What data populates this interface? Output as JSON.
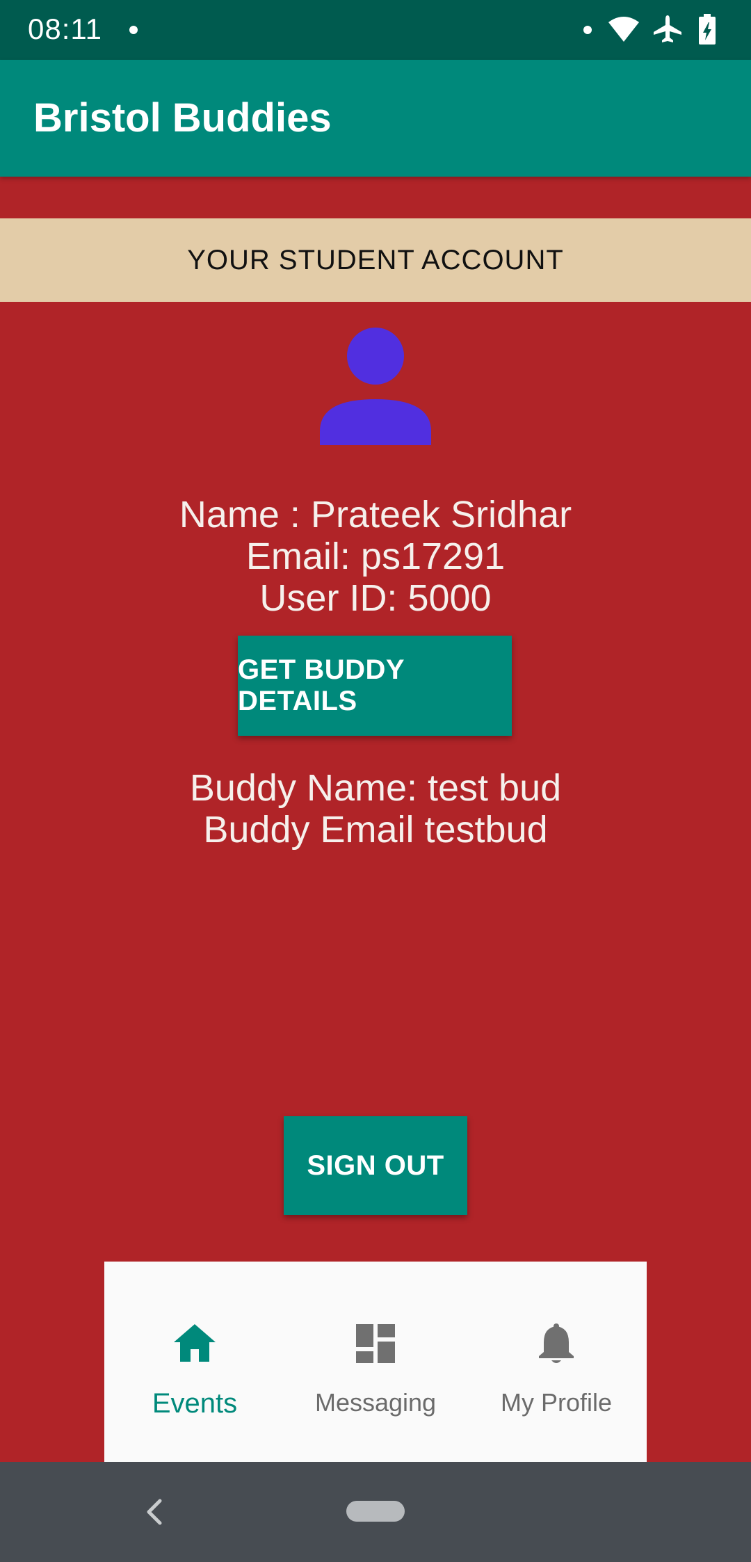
{
  "status_bar": {
    "time": "08:11"
  },
  "app_bar": {
    "title": "Bristol Buddies"
  },
  "banner": {
    "text": "YOUR STUDENT ACCOUNT"
  },
  "profile": {
    "avatar_icon": "person-icon",
    "avatar_color": "#512fe0",
    "name_line": "Name : Prateek Sridhar",
    "email_line": "Email: ps17291",
    "user_id_line": "User ID: 5000"
  },
  "buttons": {
    "get_buddy_details": "GET BUDDY DETAILS",
    "sign_out": "SIGN OUT"
  },
  "buddy": {
    "name_line": "Buddy Name: test bud",
    "email_line": "Buddy Email testbud"
  },
  "bottom_nav": {
    "items": [
      {
        "label": "Events",
        "icon": "home-icon",
        "active": true
      },
      {
        "label": "Messaging",
        "icon": "dashboard-icon",
        "active": false
      },
      {
        "label": "My Profile",
        "icon": "bell-icon",
        "active": false
      }
    ]
  },
  "colors": {
    "background": "#b02428",
    "accent": "#00897b",
    "status_bar": "#005b4f",
    "banner": "#e3cca8"
  }
}
